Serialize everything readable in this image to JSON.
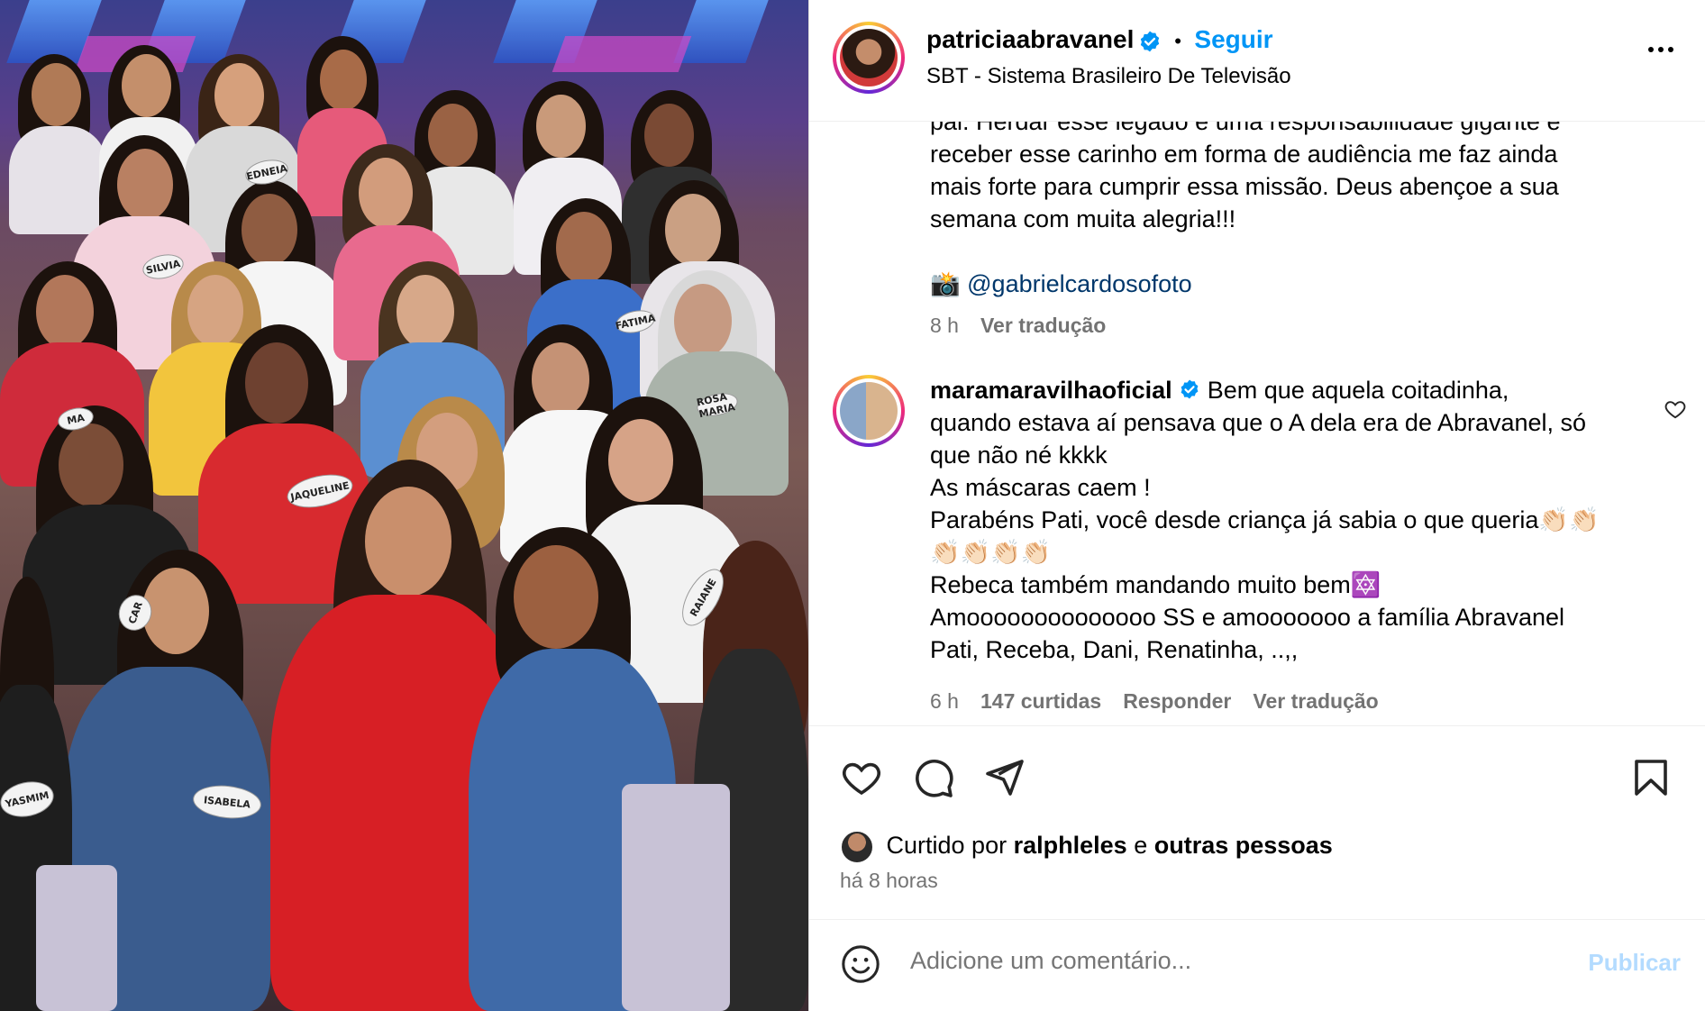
{
  "post": {
    "image_description_icon": "photo-crowd",
    "name_tags": [
      "EDNEIA",
      "SILVIA",
      "JAQUELINE",
      "RAIANE",
      "YASMIM",
      "ISABELA",
      "ROSA MARIA",
      "CAR",
      "MA",
      "FATIMA"
    ]
  },
  "header": {
    "username": "patriciaabravanel",
    "separator": "•",
    "follow_label": "Seguir",
    "location": "SBT - Sistema Brasileiro De Televisão",
    "more_icon": "more-horizontal-icon"
  },
  "caption": {
    "partial_line": "pai. Herdar esse legado é uma responsabilidade gigante e",
    "lines": [
      "receber esse carinho em forma de audiência me faz ainda",
      "mais forte para cumprir essa missão. Deus abençoe a sua",
      "semana com muita alegria!!!"
    ],
    "camera_emoji": "📸",
    "credit": "@gabrielcardosofoto",
    "time": "8 h",
    "translate": "Ver tradução"
  },
  "comment": {
    "username": "maramaravilhaoficial",
    "first_line": "Bem que aquela coitadinha,",
    "lines": [
      "quando estava aí pensava que o A dela era de Abravanel, só",
      "que não né kkkk",
      "As máscaras caem !",
      "Parabéns Pati, você desde criança já sabia o que queria👏🏻👏🏻",
      "👏🏻👏🏻👏🏻👏🏻",
      "Rebeca também mandando muito bem🔯",
      "Amoooooooooooooo SS e amooooooo a família Abravanel",
      "Pati, Receba, Dani, Renatinha, ..,,"
    ],
    "time": "6 h",
    "likes": "147 curtidas",
    "reply": "Responder",
    "translate": "Ver tradução"
  },
  "actions": {
    "like_icon": "heart-icon",
    "comment_icon": "comment-icon",
    "share_icon": "send-icon",
    "save_icon": "bookmark-icon"
  },
  "likes_summary": {
    "prefix": "Curtido por",
    "user": "ralphleles",
    "conjunction": "e",
    "others": "outras pessoas",
    "ago": "há 8 horas"
  },
  "comment_box": {
    "placeholder": "Adicione um comentário...",
    "publish_label": "Publicar",
    "emoji_icon": "smiley-icon"
  },
  "colors": {
    "accent_blue": "#0095f6",
    "link_dark": "#00376b",
    "muted": "#737373",
    "publish_disabled": "#b3dbff"
  }
}
